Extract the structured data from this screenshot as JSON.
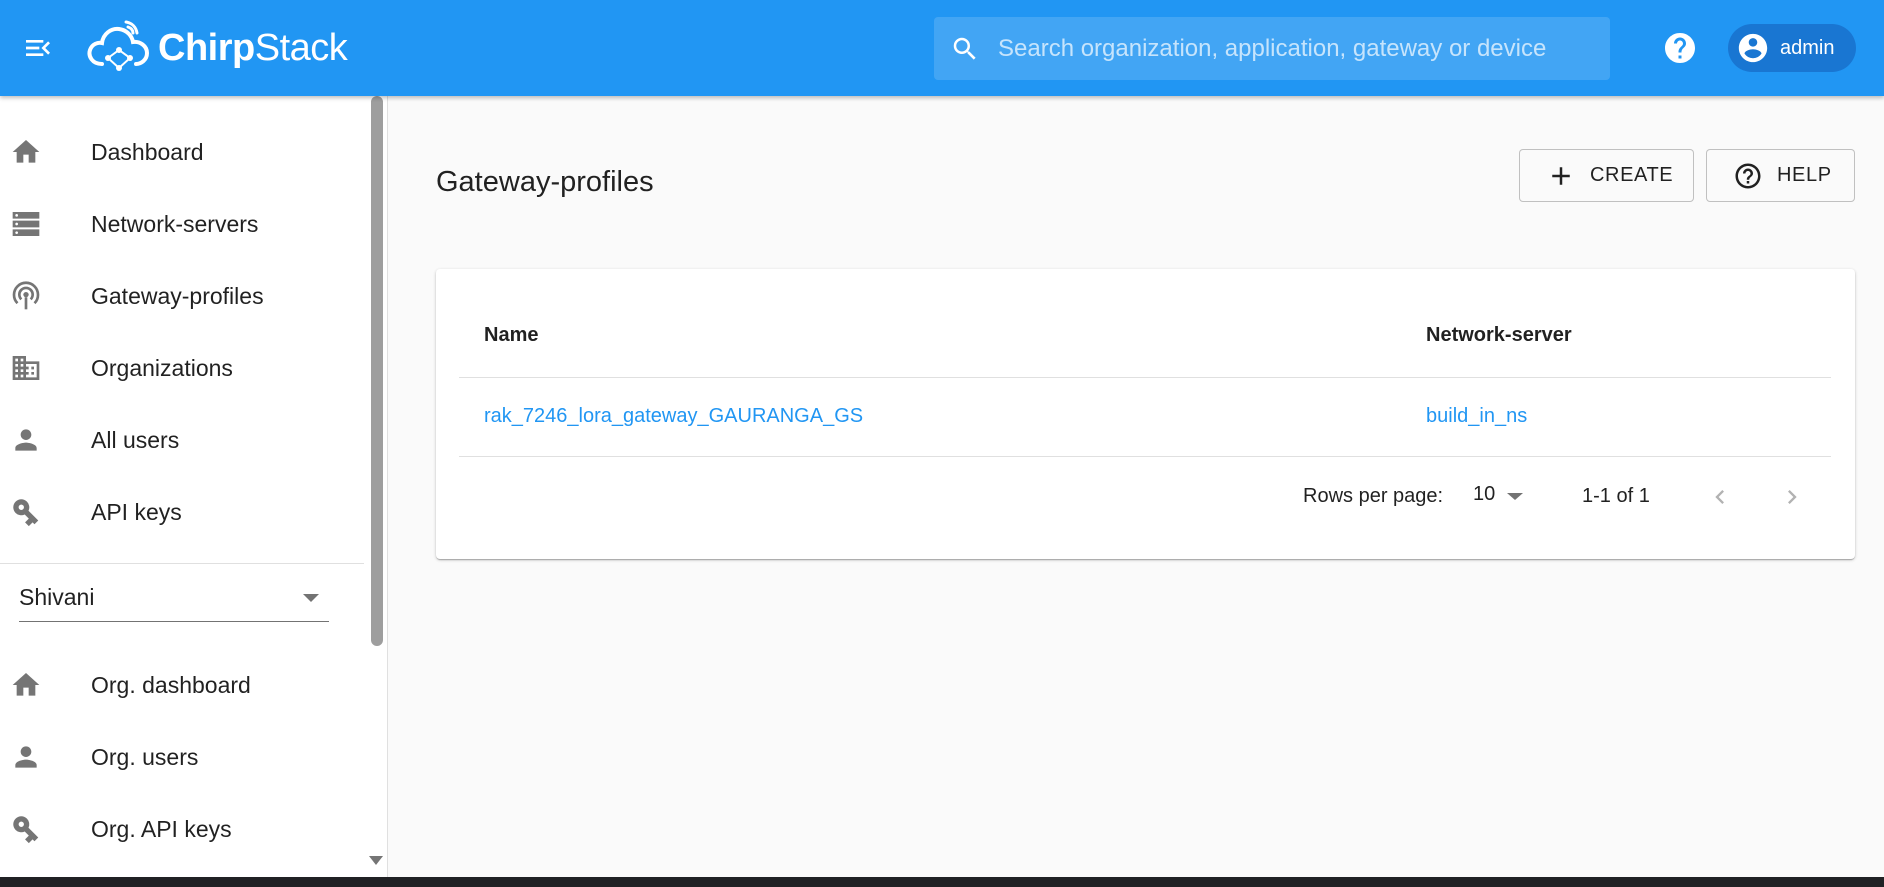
{
  "header": {
    "brand_bold": "Chirp",
    "brand_rest": "Stack",
    "search_placeholder": "Search organization, application, gateway or device",
    "user": "admin"
  },
  "sidebar": {
    "items": [
      {
        "label": "Dashboard",
        "icon": "home-icon"
      },
      {
        "label": "Network-servers",
        "icon": "server-icon"
      },
      {
        "label": "Gateway-profiles",
        "icon": "gateway-icon"
      },
      {
        "label": "Organizations",
        "icon": "building-icon"
      },
      {
        "label": "All users",
        "icon": "person-icon"
      },
      {
        "label": "API keys",
        "icon": "key-icon"
      }
    ],
    "org_selected": "Shivani",
    "org_items": [
      {
        "label": "Org. dashboard",
        "icon": "home-icon"
      },
      {
        "label": "Org. users",
        "icon": "person-icon"
      },
      {
        "label": "Org. API keys",
        "icon": "key-icon"
      }
    ]
  },
  "main": {
    "title": "Gateway-profiles",
    "create_label": "CREATE",
    "help_label": "HELP",
    "table": {
      "columns": [
        "Name",
        "Network-server"
      ],
      "rows": [
        {
          "name": "rak_7246_lora_gateway_GAURANGA_GS",
          "network_server": "build_in_ns"
        }
      ]
    },
    "pagination": {
      "rows_per_page_label": "Rows per page:",
      "rows_per_page": "10",
      "range": "1-1 of 1"
    }
  },
  "colors": {
    "primary": "#2196f3",
    "primary_dark": "#1976d2",
    "link": "#2196f3"
  }
}
